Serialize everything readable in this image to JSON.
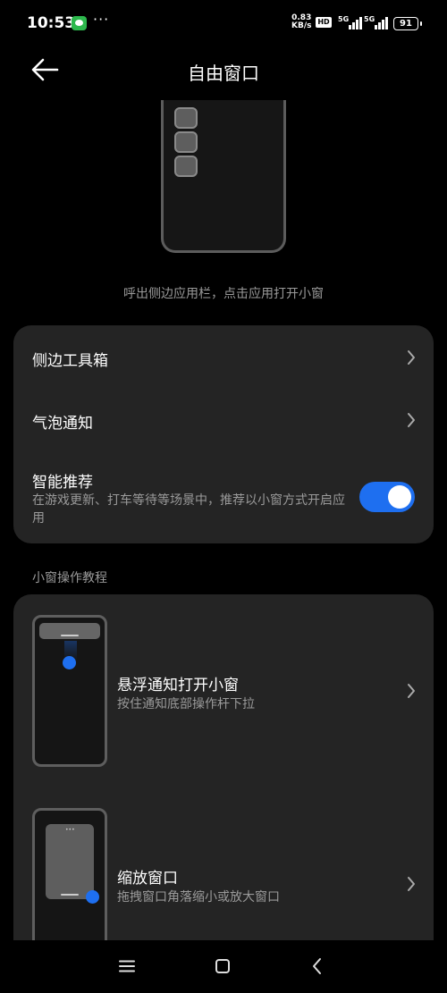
{
  "status_bar": {
    "time": "10:53",
    "more": "···",
    "net_speed_value": "0.83",
    "net_speed_unit": "KB/s",
    "hd_label": "HD",
    "signal_1_label": "5G",
    "signal_2_label": "5G",
    "battery": "91"
  },
  "header": {
    "title": "自由窗口"
  },
  "hero": {
    "caption": "呼出侧边应用栏，点击应用打开小窗"
  },
  "settings": {
    "items": [
      {
        "label": "侧边工具箱"
      },
      {
        "label": "气泡通知"
      },
      {
        "label": "智能推荐",
        "description": "在游戏更新、打车等待等场景中，推荐以小窗方式开启应用",
        "toggle_on": true
      }
    ]
  },
  "tutorial": {
    "section_label": "小窗操作教程",
    "items": [
      {
        "title": "悬浮通知打开小窗",
        "description": "按住通知底部操作杆下拉"
      },
      {
        "title": "缩放窗口",
        "description": "拖拽窗口角落缩小或放大窗口"
      }
    ]
  },
  "colors": {
    "accent": "#1e6ff0",
    "card_bg": "#242424",
    "secondary_text": "#9a9a9a"
  },
  "icons": [
    "wechat-icon",
    "more-icon",
    "hd-icon",
    "signal-icon",
    "battery-icon",
    "back-arrow-icon",
    "chevron-right-icon",
    "menu-icon",
    "home-icon",
    "back-icon"
  ]
}
